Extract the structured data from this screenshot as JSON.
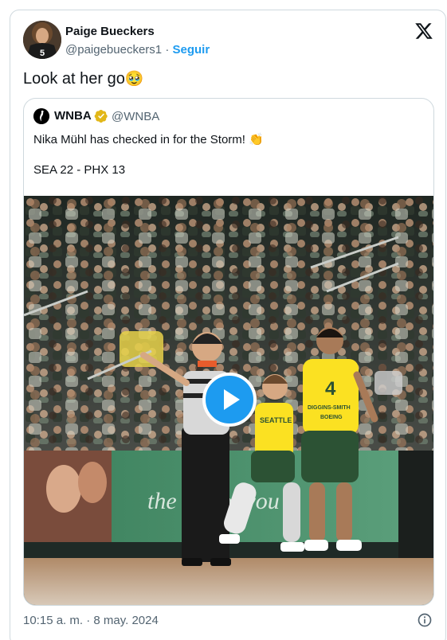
{
  "post": {
    "author_name": "Paige Bueckers",
    "author_handle": "@paigebueckers1",
    "separator": "·",
    "follow_label": "Seguir",
    "jersey_number": "5",
    "text": "Look at her go",
    "emoji": "🥹",
    "timestamp": "10:15 a. m. · 8 may. 2024"
  },
  "quoted": {
    "name": "WNBA",
    "handle": "@WNBA",
    "text": "Nika Mühl has checked in for the Storm!",
    "emoji": "👏",
    "score": "SEA 22 - PHX 13"
  },
  "video_scene": {
    "player_jersey_number": "4",
    "player_name_on_jersey": "DIGGINS-SMITH",
    "team_on_jersey": "SEATTLE",
    "sponsor_on_jersey": "BOEING",
    "ad_board_text": "the  ear of you"
  },
  "icons": {
    "brand": "x-logo-icon",
    "verified": "verified-gold-badge-icon",
    "play": "play-icon",
    "info": "info-icon"
  },
  "colors": {
    "accent_blue": "#1d9bf0",
    "text_primary": "#0f1419",
    "text_secondary": "#536471",
    "border": "#cfd9de",
    "verified_gold": "#e2b719",
    "storm_green": "#2c5234",
    "storm_yellow": "#fbe122"
  }
}
